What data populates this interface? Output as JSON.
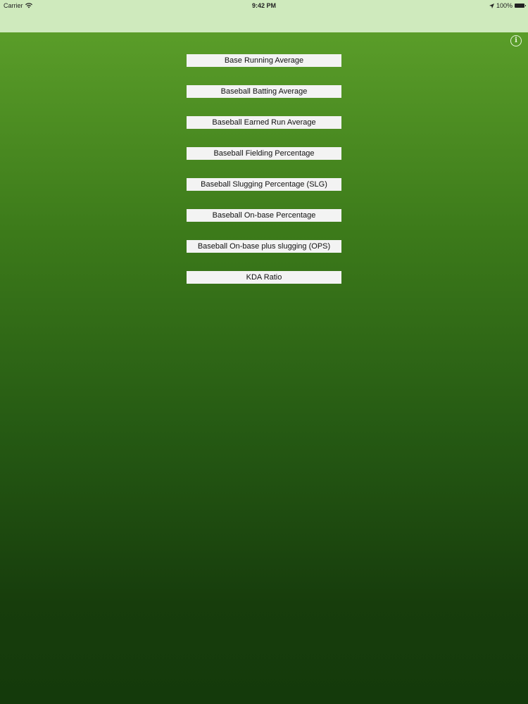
{
  "status_bar": {
    "carrier": "Carrier",
    "time": "9:42 PM",
    "battery": "100%"
  },
  "menu": {
    "items": [
      {
        "label": "Base Running Average"
      },
      {
        "label": "Baseball Batting Average"
      },
      {
        "label": "Baseball Earned Run Average"
      },
      {
        "label": "Baseball Fielding Percentage"
      },
      {
        "label": "Baseball Slugging Percentage (SLG)"
      },
      {
        "label": "Baseball On-base Percentage"
      },
      {
        "label": "Baseball On-base plus slugging (OPS)"
      },
      {
        "label": "KDA Ratio"
      }
    ]
  },
  "colors": {
    "nav_background": "#cfeabd",
    "gradient_top": "#5a9d29",
    "gradient_bottom": "#143a0b",
    "button_background": "#f3f3f3"
  }
}
